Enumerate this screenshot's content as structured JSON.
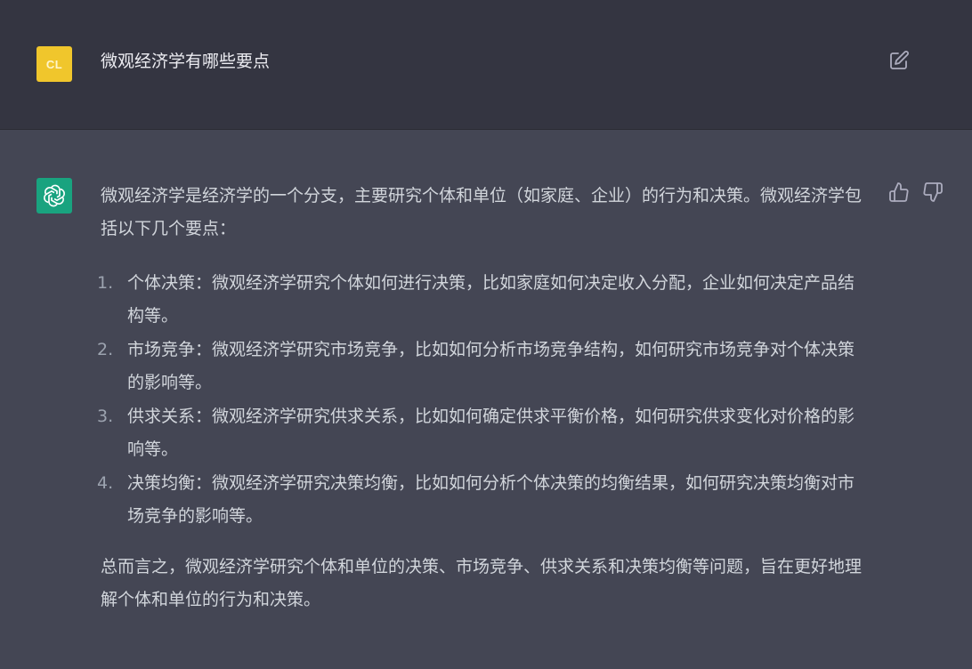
{
  "user": {
    "avatar_initials": "CL",
    "message": "微观经济学有哪些要点"
  },
  "assistant": {
    "intro": "微观经济学是经济学的一个分支，主要研究个体和单位（如家庭、企业）的行为和决策。微观经济学包括以下几个要点：",
    "points": [
      {
        "num": "1.",
        "text": "个体决策：微观经济学研究个体如何进行决策，比如家庭如何决定收入分配，企业如何决定产品结构等。"
      },
      {
        "num": "2.",
        "text": "市场竞争：微观经济学研究市场竞争，比如如何分析市场竞争结构，如何研究市场竞争对个体决策的影响等。"
      },
      {
        "num": "3.",
        "text": "供求关系：微观经济学研究供求关系，比如如何确定供求平衡价格，如何研究供求变化对价格的影响等。"
      },
      {
        "num": "4.",
        "text": "决策均衡：微观经济学研究决策均衡，比如如何分析个体决策的均衡结果，如何研究决策均衡对市场竞争的影响等。"
      }
    ],
    "conclusion": "总而言之，微观经济学研究个体和单位的决策、市场竞争、供求关系和决策均衡等问题，旨在更好地理解个体和单位的行为和决策。"
  },
  "icons": {
    "edit": "edit-icon",
    "bot_logo": "openai-logo-icon",
    "like": "thumbs-up-icon",
    "dislike": "thumbs-down-icon"
  },
  "colors": {
    "user_bg": "#343541",
    "assistant_bg": "#444654",
    "user_avatar": "#f0c62c",
    "bot_avatar": "#19a37f",
    "text": "#d1d5db"
  }
}
